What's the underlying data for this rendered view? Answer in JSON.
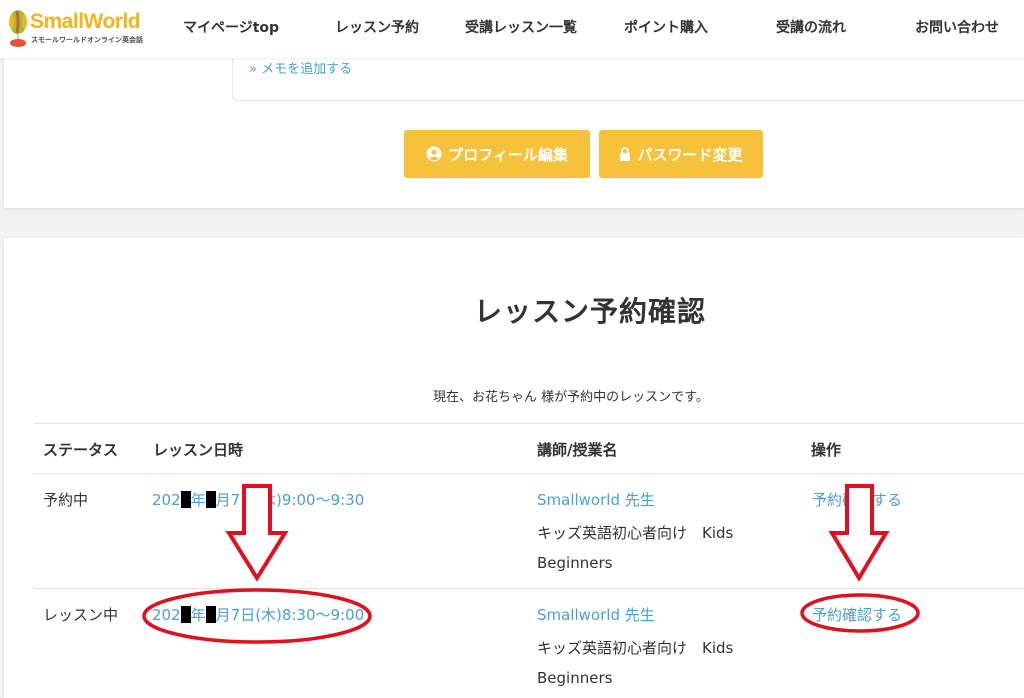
{
  "header": {
    "logo": {
      "text": "SmallWorld",
      "subtitle": "スモールワールドオンライン英会話"
    },
    "nav": [
      {
        "label": "マイページtop"
      },
      {
        "label": "レッスン予約"
      },
      {
        "label": "受講レッスン一覧"
      },
      {
        "label": "ポイント購入"
      },
      {
        "label": "受講の流れ"
      },
      {
        "label": "お問い合わせ"
      }
    ]
  },
  "profile": {
    "memo_link": "» メモを追加する",
    "edit_profile_button": "プロフィール編集",
    "change_password_button": "パスワード変更"
  },
  "lessons": {
    "title": "レッスン予約確認",
    "intro": "現在、お花ちゃん 様が予約中のレッスンです。",
    "columns": [
      "ステータス",
      "レッスン日時",
      "講師/授業名",
      "操作"
    ],
    "rows": [
      {
        "status": "予約中",
        "date_prefix": "202",
        "date_mid": "年",
        "date_suffix": "月7日(木)9:00〜9:30",
        "teacher": "Smallworld 先生",
        "course_line1": "キッズ英語初心者向け　Kids",
        "course_line2": "Beginners",
        "action": "予約確認する"
      },
      {
        "status": "レッスン中",
        "date_prefix": "202",
        "date_mid": "年",
        "date_suffix": "月7日(木)8:30〜9:00",
        "teacher": "Smallworld 先生",
        "course_line1": "キッズ英語初心者向け　Kids",
        "course_line2": "Beginners",
        "action": "予約確認する"
      }
    ]
  },
  "colors": {
    "accent": "#f6c13b",
    "link": "#4a9fd5",
    "annotation": "#e0101f"
  }
}
